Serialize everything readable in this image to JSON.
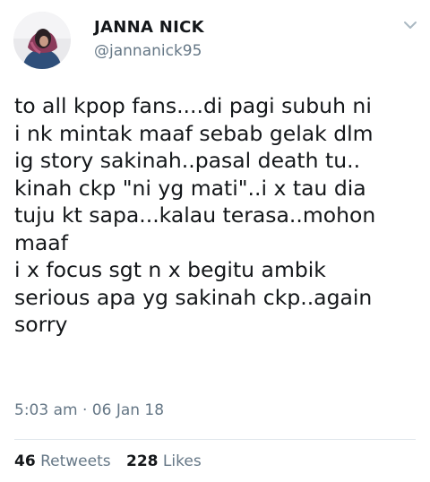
{
  "user": {
    "name": "JANNA NICK",
    "handle": "@jannanick95"
  },
  "tweet": {
    "lines": [
      "to all kpop fans....di pagi subuh ni",
      "i nk mintak maaf sebab gelak dlm",
      "ig story sakinah..pasal death tu..",
      "kinah ckp \"ni yg mati\"..i x tau dia",
      "tuju kt sapa...kalau terasa..mohon",
      "maaf",
      "i x focus sgt n x begitu ambik",
      "serious apa yg sakinah ckp..again",
      "sorry"
    ],
    "time": "5:03 am",
    "separator": "·",
    "date": "06 Jan 18"
  },
  "stats": {
    "retweets_count": "46",
    "retweets_label": "Retweets",
    "likes_count": "228",
    "likes_label": "Likes"
  },
  "icons": {
    "avatar": "profile-photo",
    "menu": "chevron-down-icon"
  },
  "colors": {
    "text": "#14171a",
    "secondary": "#657786",
    "divider": "#e1e8ed"
  }
}
